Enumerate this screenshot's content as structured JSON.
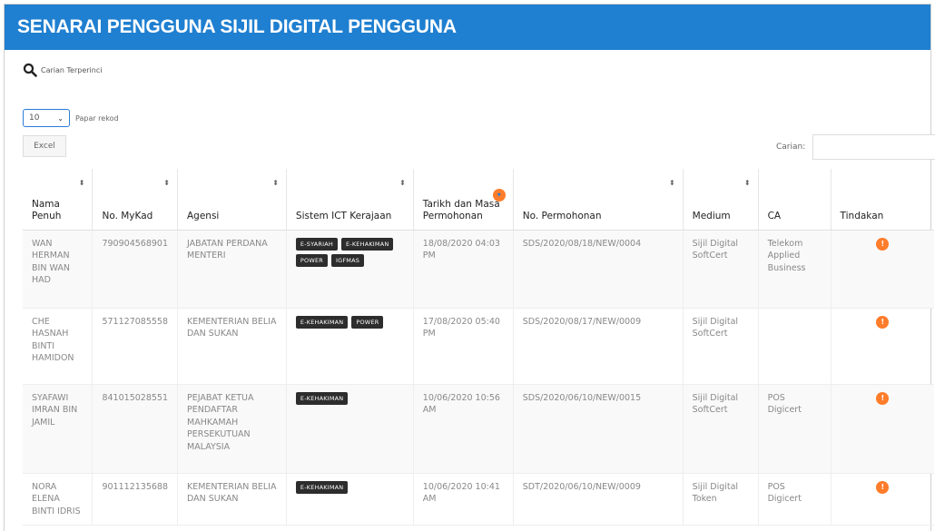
{
  "title": "SENARAI PENGGUNA SIJIL DIGITAL PENGGUNA",
  "advanced_search_label": "Carian Terperinci",
  "page_length": {
    "value": "10",
    "label": "Papar rekod"
  },
  "excel_label": "Excel",
  "search_label": "Carian:",
  "colors": {
    "header": "#1f7fd0",
    "action": "#ff7c2a",
    "badge": "#2d2d2d"
  },
  "icons": {
    "search": "search-icon",
    "action": "action-icon",
    "sort": "sort-icon",
    "dropdown": "chevron-down-icon"
  },
  "columns": [
    {
      "label": "Nama Penuh"
    },
    {
      "label": "No. MyKad"
    },
    {
      "label": "Agensi"
    },
    {
      "label": "Sistem ICT Kerajaan"
    },
    {
      "label": "Tarikh dan Masa Permohonan"
    },
    {
      "label": "No. Permohonan"
    },
    {
      "label": "Medium"
    },
    {
      "label": "CA"
    },
    {
      "label": "Tindakan"
    }
  ],
  "rows": [
    {
      "nama": "WAN HERMAN BIN WAN HAD",
      "mykad": "790904568901",
      "agensi": "JABATAN PERDANA MENTERI",
      "sistem": [
        "E-SYARIAH",
        "E-KEHAKIMAN",
        "POWER",
        "IGFMAS"
      ],
      "tarikh": "18/08/2020 04:03 PM",
      "permohonan": "SDS/2020/08/18/NEW/0004",
      "medium": "Sijil Digital SoftCert",
      "ca": "Telekom Applied Business"
    },
    {
      "nama": "CHE HASNAH BINTI HAMIDON",
      "mykad": "571127085558",
      "agensi": "KEMENTERIAN BELIA DAN SUKAN",
      "sistem": [
        "E-KEHAKIMAN",
        "POWER"
      ],
      "tarikh": "17/08/2020 05:40 PM",
      "permohonan": "SDS/2020/08/17/NEW/0009",
      "medium": "Sijil Digital SoftCert",
      "ca": ""
    },
    {
      "nama": "SYAFAWI IMRAN BIN JAMIL",
      "mykad": "841015028551",
      "agensi": "PEJABAT KETUA PENDAFTAR MAHKAMAH PERSEKUTUAN MALAYSIA",
      "sistem": [
        "E-KEHAKIMAN"
      ],
      "tarikh": "10/06/2020 10:56 AM",
      "permohonan": "SDS/2020/06/10/NEW/0015",
      "medium": "Sijil Digital SoftCert",
      "ca": "POS Digicert"
    },
    {
      "nama": "NORA ELENA BINTI IDRIS",
      "mykad": "901112135688",
      "agensi": "KEMENTERIAN BELIA DAN SUKAN",
      "sistem": [
        "E-KEHAKIMAN"
      ],
      "tarikh": "10/06/2020 10:41 AM",
      "permohonan": "SDT/2020/06/10/NEW/0009",
      "medium": "Sijil Digital Token",
      "ca": "POS Digicert"
    }
  ]
}
